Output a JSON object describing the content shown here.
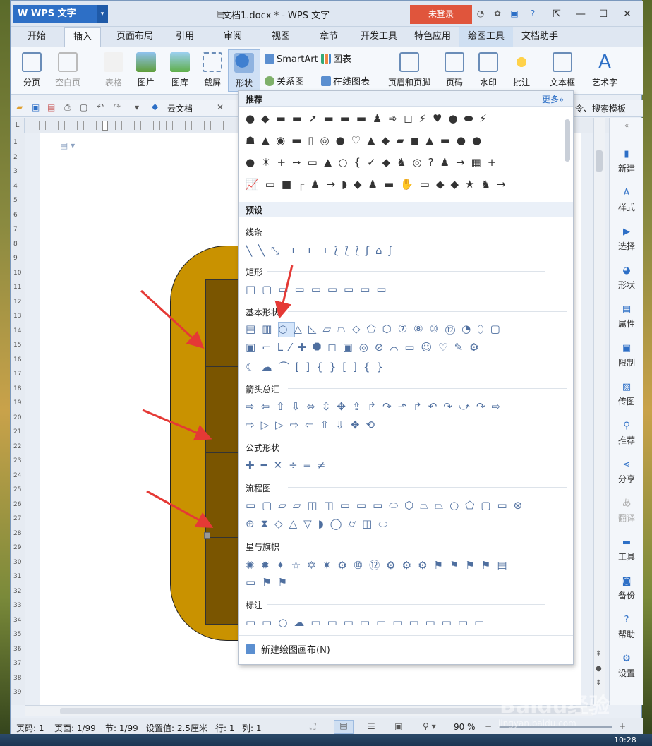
{
  "window": {
    "app_name": "WPS 文字",
    "doc_title": "文档1.docx * - WPS 文字",
    "login": "未登录"
  },
  "tabs": [
    "开始",
    "插入",
    "页面布局",
    "引用",
    "审阅",
    "视图",
    "章节",
    "开发工具",
    "特色应用",
    "绘图工具",
    "文档助手"
  ],
  "ribbon": {
    "fenye": "分页",
    "kongbaiye": "空白页",
    "biaoge": "表格",
    "tupian": "图片",
    "tuku": "图库",
    "jieping": "截屏",
    "xingzhuang": "形状",
    "smartart": "SmartArt",
    "tubiao": "图表",
    "guanxitu": "关系图",
    "zaixiantubiao": "在线图表",
    "yemei": "页眉和页脚",
    "yema": "页码",
    "shuiyin": "水印",
    "pizhu": "批注",
    "wenbenkuang": "文本框",
    "yishuzi": "艺术字"
  },
  "qat": {
    "cloud_tab": "云文档",
    "search_hint": "找命令、搜索模板"
  },
  "dropdown": {
    "recommend_title": "推荐",
    "more": "更多»",
    "recommend_rows": [
      "●◆▬▬➚▬▬▬♟➾◻⚡♥●⬬⚡",
      "☗▲◉▬▯◎●♡▲◆▰◼▲▬●●",
      "●☀+➙▭▲○{✓◆♞◎?♟→▦+",
      "📈▭■┌♟→◗◆♟▬✋▭◆◆★♞→"
    ],
    "preset_title": "预设",
    "categories": [
      {
        "name": "线条",
        "rows": [
          "╲╲⤡ㄱㄱㄱ⟅⟅⟅ʃ⌂ʃ"
        ]
      },
      {
        "name": "矩形",
        "rows": [
          "□▢▭▭▭▭▭▭▭"
        ]
      },
      {
        "name": "基本形状",
        "rows": [
          "▤▥○△◺▱⏢◇⬠⬡⑦⑧⑩⑫◔⬯▢",
          "▣⌐L⁄✚⯃◻▣◎⊘⌒▭☺♡✎⚙",
          "☾☁⌒[]{}[]{}"
        ]
      },
      {
        "name": "箭头总汇",
        "rows": [
          "⇨⇦⇧⇩⬄⇳✥⇪↱↷⬏↱↶↷⤻↷⇨",
          "⇨▷▷⇨⇦⇧⇩✥⟲"
        ]
      },
      {
        "name": "公式形状",
        "rows": [
          "✚━✕÷═≠"
        ]
      },
      {
        "name": "流程图",
        "rows": [
          "▭▢⏥▱◫◫▭▭▭⬭⬡⏢⏢○⬠▢▭⊗",
          "⊕⧗◇△▽◗◯⌭◫⬭"
        ]
      },
      {
        "name": "星与旗帜",
        "rows": [
          "✺✹✦☆✡✷⚙⑩⑫⚙⚙⚙⚑⚑⚑⚑▤",
          "▭⚑⚑"
        ]
      },
      {
        "name": "标注",
        "rows": [
          "▭▭○☁▭▭▭▭▭▭▭▭▭▭▭"
        ]
      }
    ],
    "new_canvas": "新建绘图画布(N)"
  },
  "sidepanel": [
    "新建",
    "样式",
    "选择",
    "形状",
    "属性",
    "限制",
    "传图",
    "推荐",
    "分享",
    "翻译",
    "工具",
    "备份",
    "帮助",
    "设置"
  ],
  "status": {
    "page": "页码: 1",
    "pages": "页面: 1/99",
    "section": "节: 1/99",
    "setting": "设置值: 2.5厘米",
    "row": "行: 1",
    "col": "列: 1",
    "zoom": "90 %"
  },
  "taskbar": {
    "time": "10:28"
  },
  "watermark": {
    "text": "Baidu经验",
    "url": "jingyan.baidu.com"
  },
  "colors": {
    "accent": "#2d6fc6",
    "login_bg": "#e0553c",
    "shape_outer": "#c99200",
    "shape_inner": "#7a5500",
    "arrow": "#e53935"
  }
}
